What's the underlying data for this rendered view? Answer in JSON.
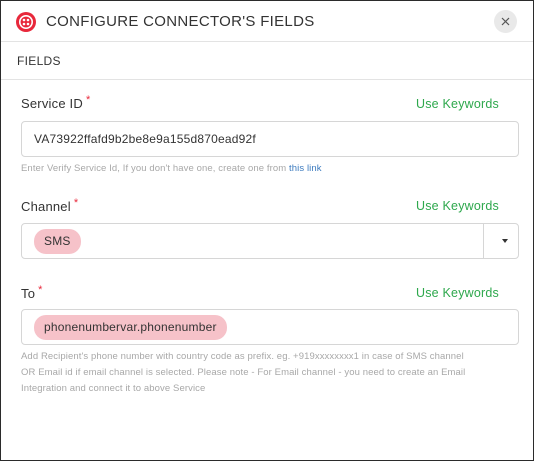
{
  "dialog": {
    "title": "CONFIGURE CONNECTOR'S FIELDS",
    "logo_icon": "twilio-logo-icon",
    "close_icon": "close-icon",
    "brand_color": "#e8283b"
  },
  "section": {
    "label": "FIELDS"
  },
  "fields": {
    "service_id": {
      "label": "Service ID",
      "required_mark": "*",
      "keywords_link": "Use Keywords",
      "value": "VA73922ffafd9b2be8e9a155d870ead92f",
      "help_text": "Enter Verify Service Id, If you don't have one, create one from ",
      "help_link": "this link"
    },
    "channel": {
      "label": "Channel",
      "required_mark": "*",
      "keywords_link": "Use Keywords",
      "selected": "SMS",
      "dropdown_icon": "caret-down-icon"
    },
    "to": {
      "label": "To",
      "required_mark": "*",
      "keywords_link": "Use Keywords",
      "value": "phonenumbervar.phonenumber",
      "help_line1": "Add Recipient's phone number with country code as prefix. eg. +919xxxxxxxx1 in case of SMS channel",
      "help_line2": "OR Email id if email channel is selected. Please note - For Email channel - you need to create an Email",
      "help_line3": "Integration and connect it to above Service"
    }
  },
  "colors": {
    "link_green": "#2ea84d",
    "chip_pink": "#f6c2c9",
    "link_blue": "#3d7bbf"
  }
}
